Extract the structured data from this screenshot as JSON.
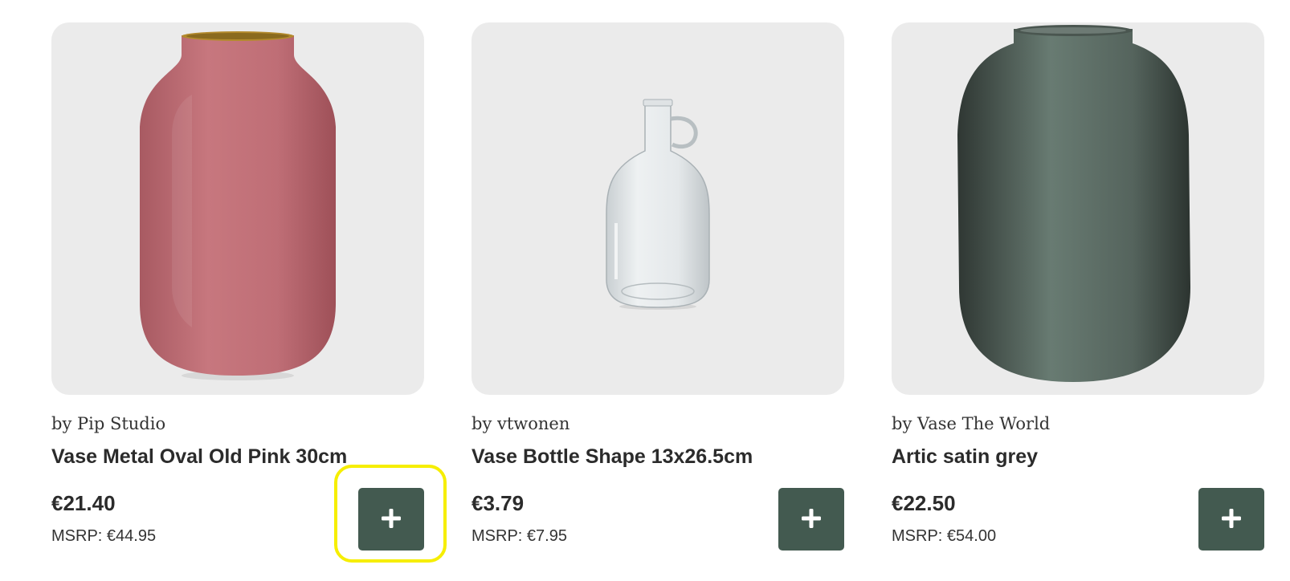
{
  "products": [
    {
      "brand": "by Pip Studio",
      "title": "Vase Metal Oval Old Pink 30cm",
      "price": "€21.40",
      "msrp": "MSRP: €44.95",
      "image": "pink-oval-vase",
      "color": "#c07178"
    },
    {
      "brand": "by vtwonen",
      "title": "Vase Bottle Shape 13x26.5cm",
      "price": "€3.79",
      "msrp": "MSRP: €7.95",
      "image": "glass-bottle-vase",
      "color": "#dfe4e6"
    },
    {
      "brand": "by Vase The World",
      "title": "Artic satin grey",
      "price": "€22.50",
      "msrp": "MSRP: €54.00",
      "image": "grey-satin-vase",
      "color": "#56625d"
    }
  ],
  "add_button_icon": "plus-icon",
  "accent_color": "#435a50",
  "highlight_color": "#f6ee00"
}
